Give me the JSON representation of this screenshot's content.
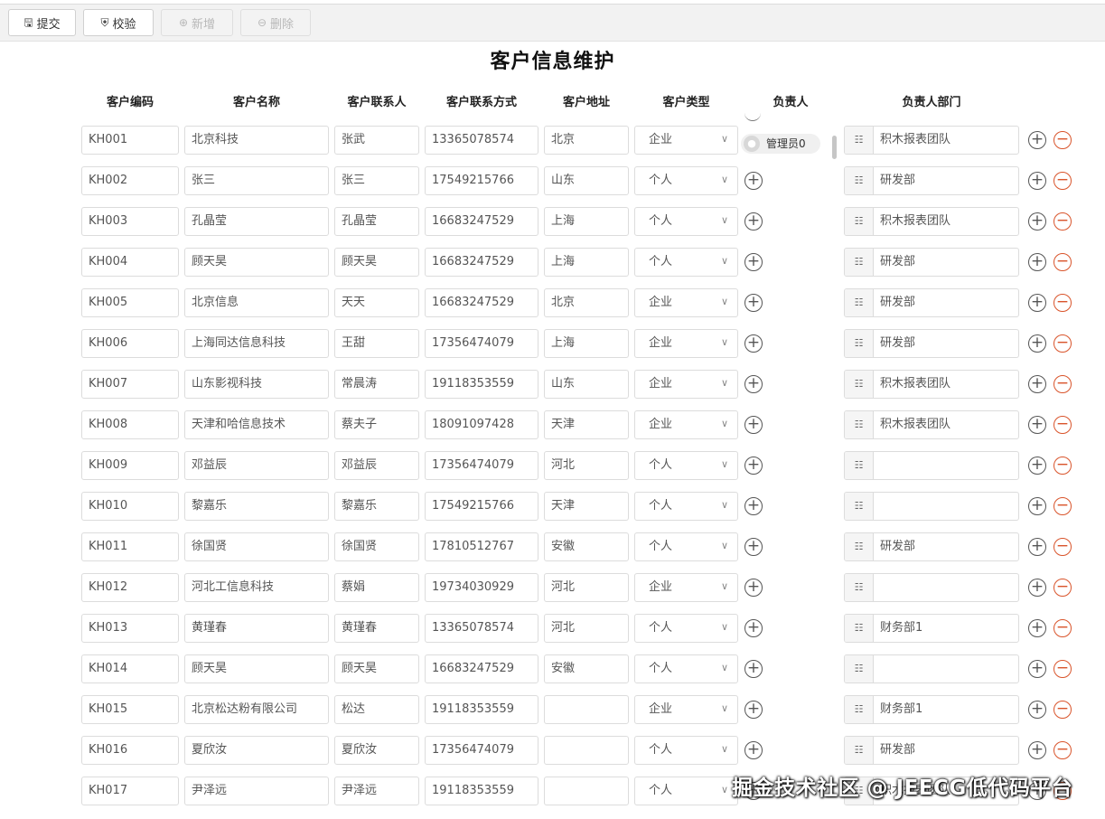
{
  "toolbar": {
    "buttons": [
      {
        "label": "提交",
        "icon": "save-icon",
        "disabled": false
      },
      {
        "label": "校验",
        "icon": "shield-check-icon",
        "disabled": false
      },
      {
        "label": "新增",
        "icon": "plus-circle-icon",
        "disabled": true
      },
      {
        "label": "删除",
        "icon": "minus-circle-icon",
        "disabled": true
      }
    ]
  },
  "page": {
    "title": "客户信息维护"
  },
  "columns": [
    "客户编码",
    "客户名称",
    "客户联系人",
    "客户联系方式",
    "客户地址",
    "客户类型",
    "负责人",
    "负责人部门"
  ],
  "rows": [
    {
      "code": "KH001",
      "name": "北京科技",
      "contact": "张武",
      "phone": "13365078574",
      "address": "北京",
      "type": "企业",
      "owner": "管理员0",
      "dept": "积木报表团队"
    },
    {
      "code": "KH002",
      "name": "张三",
      "contact": "张三",
      "phone": "17549215766",
      "address": "山东",
      "type": "个人",
      "owner": "",
      "dept": "研发部"
    },
    {
      "code": "KH003",
      "name": "孔晶莹",
      "contact": "孔晶莹",
      "phone": "16683247529",
      "address": "上海",
      "type": "个人",
      "owner": "",
      "dept": "积木报表团队"
    },
    {
      "code": "KH004",
      "name": "顾天昊",
      "contact": "顾天昊",
      "phone": "16683247529",
      "address": "上海",
      "type": "个人",
      "owner": "",
      "dept": "研发部"
    },
    {
      "code": "KH005",
      "name": "北京信息",
      "contact": "天天",
      "phone": "16683247529",
      "address": "北京",
      "type": "企业",
      "owner": "",
      "dept": "研发部"
    },
    {
      "code": "KH006",
      "name": "上海同达信息科技",
      "contact": "王甜",
      "phone": "17356474079",
      "address": "上海",
      "type": "企业",
      "owner": "",
      "dept": "研发部"
    },
    {
      "code": "KH007",
      "name": "山东影视科技",
      "contact": "常晨涛",
      "phone": "19118353559",
      "address": "山东",
      "type": "企业",
      "owner": "",
      "dept": "积木报表团队"
    },
    {
      "code": "KH008",
      "name": "天津和哈信息技术",
      "contact": "蔡夫子",
      "phone": "18091097428",
      "address": "天津",
      "type": "企业",
      "owner": "",
      "dept": "积木报表团队"
    },
    {
      "code": "KH009",
      "name": "邓益辰",
      "contact": "邓益辰",
      "phone": "17356474079",
      "address": "河北",
      "type": "个人",
      "owner": "",
      "dept": ""
    },
    {
      "code": "KH010",
      "name": "黎嘉乐",
      "contact": "黎嘉乐",
      "phone": "17549215766",
      "address": "天津",
      "type": "个人",
      "owner": "",
      "dept": ""
    },
    {
      "code": "KH011",
      "name": "徐国贤",
      "contact": "徐国贤",
      "phone": "17810512767",
      "address": "安徽",
      "type": "个人",
      "owner": "",
      "dept": "研发部"
    },
    {
      "code": "KH012",
      "name": "河北工信息科技",
      "contact": "蔡娟",
      "phone": "19734030929",
      "address": "河北",
      "type": "企业",
      "owner": "",
      "dept": ""
    },
    {
      "code": "KH013",
      "name": "黄瑾春",
      "contact": "黄瑾春",
      "phone": "13365078574",
      "address": "河北",
      "type": "个人",
      "owner": "",
      "dept": "财务部1"
    },
    {
      "code": "KH014",
      "name": "顾天昊",
      "contact": "顾天昊",
      "phone": "16683247529",
      "address": "安徽",
      "type": "个人",
      "owner": "",
      "dept": ""
    },
    {
      "code": "KH015",
      "name": "北京松达粉有限公司",
      "contact": "松达",
      "phone": "19118353559",
      "address": "",
      "type": "企业",
      "owner": "",
      "dept": "财务部1"
    },
    {
      "code": "KH016",
      "name": "夏欣汝",
      "contact": "夏欣汝",
      "phone": "17356474079",
      "address": "",
      "type": "个人",
      "owner": "",
      "dept": "研发部"
    },
    {
      "code": "KH017",
      "name": "尹泽远",
      "contact": "尹泽远",
      "phone": "19118353559",
      "address": "",
      "type": "个人",
      "owner": "",
      "dept": "积木报表团队"
    }
  ],
  "watermark": "掘金技术社区 @ JEECG低代码平台",
  "colors": {
    "delete": "#d9542b",
    "border": "#dcdcdc",
    "toolbar_bg": "#f2f2f2"
  }
}
